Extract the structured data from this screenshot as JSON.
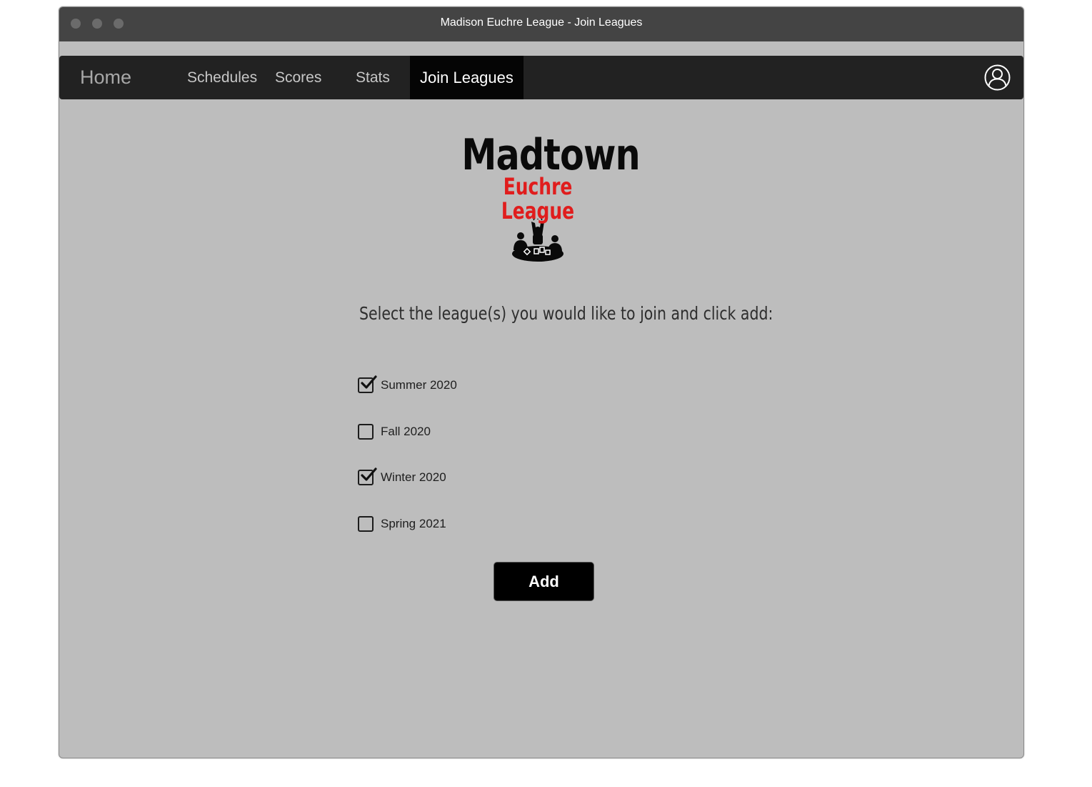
{
  "window": {
    "title": "Madison Euchre League - Join Leagues"
  },
  "nav": {
    "home": "Home",
    "schedules": "Schedules",
    "scores": "Scores",
    "stats": "Stats",
    "join_leagues": "Join Leagues",
    "active_tab": "Join Leagues",
    "user_icon": "user-account-icon"
  },
  "logo": {
    "main": "Madtown",
    "sub": "Euchre League",
    "art_icon": "card-players-table-icon",
    "colors": {
      "main": "#0a0a0a",
      "sub": "#e01d1d"
    }
  },
  "form": {
    "prompt": "Select the league(s) you would like to join and click add:",
    "options": [
      {
        "label": "Summer 2020",
        "checked": true
      },
      {
        "label": "Fall 2020",
        "checked": false
      },
      {
        "label": "Winter 2020",
        "checked": true
      },
      {
        "label": "Spring 2021",
        "checked": false
      }
    ],
    "add_label": "Add"
  }
}
